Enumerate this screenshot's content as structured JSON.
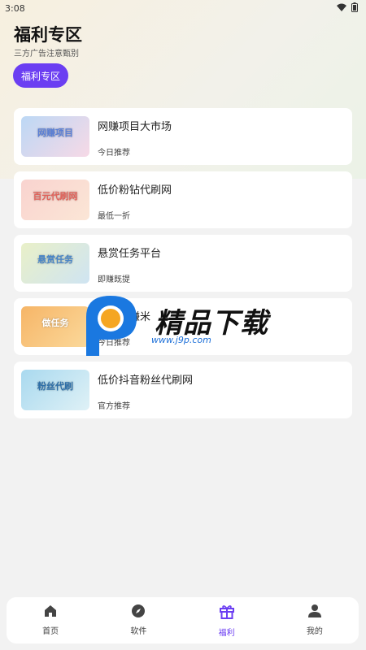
{
  "status": {
    "time": "3:08"
  },
  "header": {
    "title": "福利专区",
    "subtitle": "三方广告注意甄别"
  },
  "tab": {
    "label": "福利专区"
  },
  "items": [
    {
      "title": "网赚项目大市场",
      "sub": "今日推荐",
      "thumb_text": "网赚项目"
    },
    {
      "title": "低价粉钻代刷网",
      "sub": "最低一折",
      "thumb_text": "百元代刷网"
    },
    {
      "title": "悬赏任务平台",
      "sub": "即赚既提",
      "thumb_text": "悬赏任务"
    },
    {
      "title": "做任务赚米",
      "sub": "今日推荐",
      "thumb_text": "做任务"
    },
    {
      "title": "低价抖音粉丝代刷网",
      "sub": "官方推荐",
      "thumb_text": "粉丝代刷"
    }
  ],
  "watermark": {
    "name": "精品下载",
    "url": "www.j9p.com"
  },
  "nav": [
    {
      "label": "首页"
    },
    {
      "label": "软件"
    },
    {
      "label": "福利"
    },
    {
      "label": "我的"
    }
  ],
  "colors": {
    "accent": "#6b3ef2"
  }
}
